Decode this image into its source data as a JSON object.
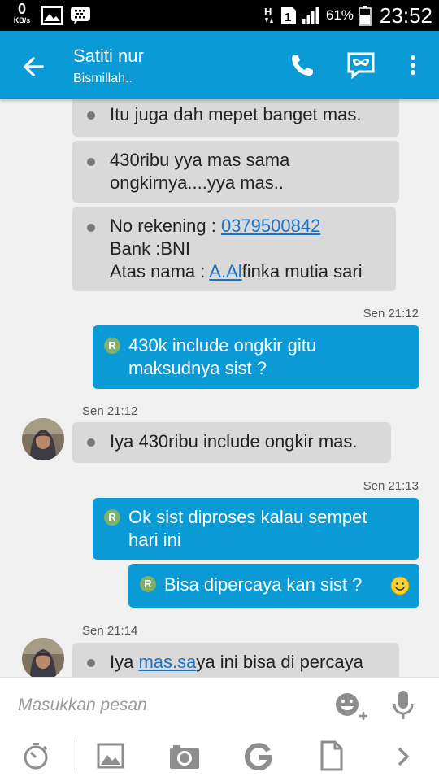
{
  "status_bar": {
    "net_speed_value": "0",
    "net_speed_unit": "KB/s",
    "sim_label": "1",
    "battery_percent": "61%",
    "time": "23:52"
  },
  "header": {
    "title": "Satiti nur",
    "subtitle": "Bismillah.."
  },
  "messages": {
    "m1": "Itu juga dah mepet banget mas.",
    "m2_line1": "430ribu yya mas sama",
    "m2_line2": "ongkirnya....yya mas..",
    "m3_l1_text": "No rekening : ",
    "m3_l1_link": "0379500842",
    "m3_l2": "Bank :BNI",
    "m3_l3_text": "Atas nama : ",
    "m3_l3_link": "A.Al",
    "m3_l3_rest": "finka mutia sari",
    "ts1": "Sen 21:12",
    "m4_line1": "430k include ongkir gitu",
    "m4_line2": "maksudnya sist ?",
    "ts2": "Sen 21:12",
    "m5": "Iya 430ribu include ongkir mas.",
    "ts3": "Sen 21:13",
    "m6_line1": "Ok sist diproses kalau sempet",
    "m6_line2": "hari ini",
    "m7": "Bisa dipercaya kan sist ?",
    "ts4": "Sen 21:14",
    "m8_text": "Iya ",
    "m8_link_a": "mas.sa",
    "m8_rest": "ya ini bisa di percaya",
    "sent_badge": "R"
  },
  "composer": {
    "placeholder": "Masukkan pesan"
  },
  "icons": {
    "back": "arrow-left-icon",
    "call": "phone-icon",
    "video": "mask-chat-icon",
    "more": "more-vert-icon",
    "emoji": "emoji-add-icon",
    "mic": "mic-icon",
    "timer": "timer-icon",
    "gallery": "image-icon",
    "camera": "camera-icon",
    "g": "g-icon",
    "file": "file-icon",
    "next": "chevron-right-icon"
  },
  "colors": {
    "accent": "#0a9ad6",
    "incoming_bubble": "#d9d9d9",
    "link": "#1a73c8"
  }
}
